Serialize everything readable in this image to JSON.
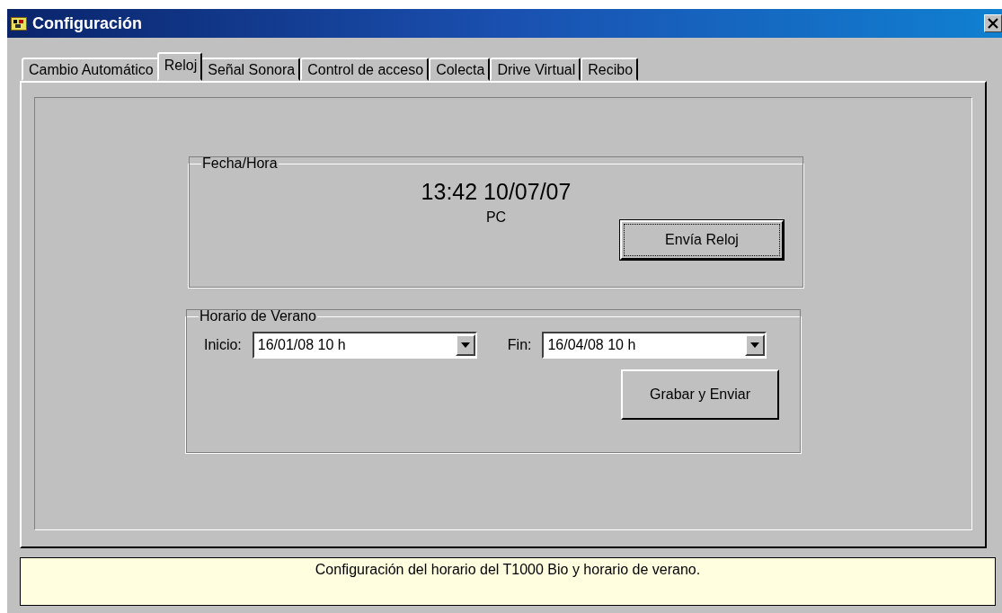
{
  "window": {
    "title": "Configuración"
  },
  "tabs": [
    {
      "label": "Cambio Automático",
      "selected": false
    },
    {
      "label": "Reloj",
      "selected": true
    },
    {
      "label": "Señal Sonora",
      "selected": false
    },
    {
      "label": "Control de acceso",
      "selected": false
    },
    {
      "label": "Colecta",
      "selected": false
    },
    {
      "label": "Drive Virtual",
      "selected": false
    },
    {
      "label": "Recibo",
      "selected": false
    }
  ],
  "clock_group": {
    "legend": "Fecha/Hora",
    "time": "13:42 10/07/07",
    "source": "PC",
    "button": {
      "label": "Envía Reloj",
      "focused": true
    }
  },
  "dst_group": {
    "legend": "Horario de Verano",
    "start_label": "Inicio:",
    "start_value": "16/01/08 10 h",
    "end_label": "Fin:",
    "end_value": "16/04/08 10 h",
    "button": {
      "label": "Grabar y Enviar",
      "focused": false
    }
  },
  "status_bar": "Configuración del horario del T1000 Bio y horario de verano."
}
